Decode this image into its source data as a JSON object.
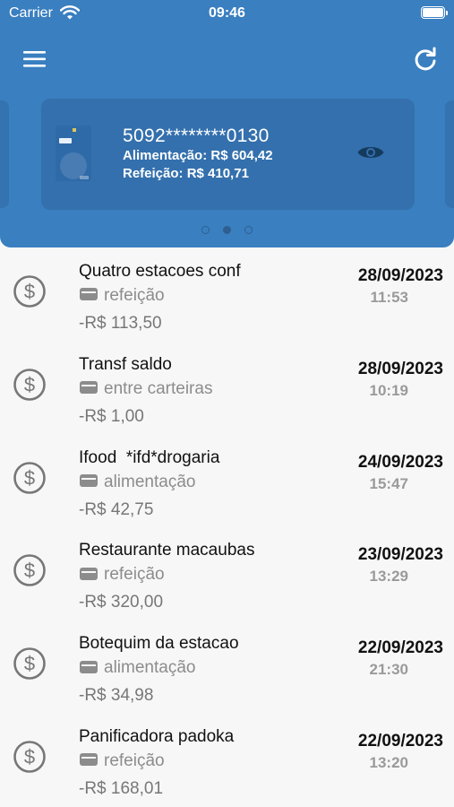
{
  "status_bar": {
    "carrier": "Carrier",
    "time": "09:46"
  },
  "header": {
    "menu_icon": "hamburger-menu-icon",
    "refresh_icon": "refresh-icon",
    "background_color": "#3a7fc0"
  },
  "card": {
    "number": "5092********0130",
    "alimentacao": "Alimentação: R$ 604,42",
    "refeicao": "Refeição: R$ 410,71",
    "eye_icon": "eye-icon"
  },
  "pager": {
    "count": 3,
    "active_index": 1
  },
  "transactions": [
    {
      "name": "Quatro estacoes conf",
      "category": "refeição",
      "amount": "-R$ 113,50",
      "date": "28/09/2023",
      "time": "11:53"
    },
    {
      "name": "Transf saldo",
      "category": "entre carteiras",
      "amount": "-R$ 1,00",
      "date": "28/09/2023",
      "time": "10:19"
    },
    {
      "name": "Ifood  *ifd*drogaria",
      "category": "alimentação",
      "amount": "-R$ 42,75",
      "date": "24/09/2023",
      "time": "15:47"
    },
    {
      "name": "Restaurante macaubas",
      "category": "refeição",
      "amount": "-R$ 320,00",
      "date": "23/09/2023",
      "time": "13:29"
    },
    {
      "name": "Botequim da estacao",
      "category": "alimentação",
      "amount": "-R$ 34,98",
      "date": "22/09/2023",
      "time": "21:30"
    },
    {
      "name": "Panificadora padoka",
      "category": "refeição",
      "amount": "-R$ 168,01",
      "date": "22/09/2023",
      "time": "13:20"
    }
  ]
}
